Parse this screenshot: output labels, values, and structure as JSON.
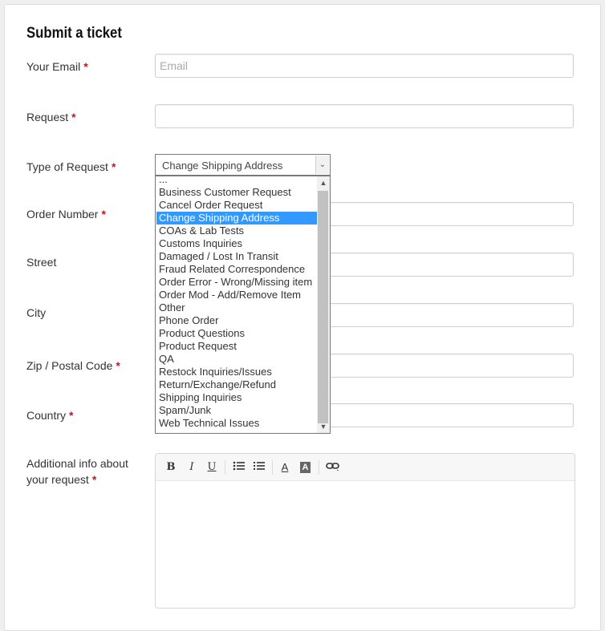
{
  "form": {
    "title": "Submit a ticket",
    "required_mark": "*",
    "email": {
      "label": "Your Email",
      "placeholder": "Email",
      "value": ""
    },
    "request": {
      "label": "Request",
      "value": ""
    },
    "type": {
      "label": "Type of Request",
      "selected": "Change Shipping Address",
      "options": [
        "...",
        "Business Customer Request",
        "Cancel Order Request",
        "Change Shipping Address",
        "COAs & Lab Tests",
        "Customs Inquiries",
        "Damaged / Lost In Transit",
        "Fraud Related Correspondence",
        "Order Error - Wrong/Missing item",
        "Order Mod - Add/Remove Item",
        "Other",
        "Phone Order",
        "Product Questions",
        "Product Request",
        "QA",
        "Restock Inquiries/Issues",
        "Return/Exchange/Refund",
        "Shipping Inquiries",
        "Spam/Junk",
        "Web Technical Issues"
      ]
    },
    "order_number": {
      "label": "Order Number"
    },
    "street": {
      "label": "Street"
    },
    "city": {
      "label": "City"
    },
    "zip": {
      "label": "Zip / Postal Code"
    },
    "country": {
      "label": "Country"
    },
    "additional": {
      "label_line1": "Additional info about",
      "label_line2": "your request"
    },
    "toolbar": {
      "bold": "B",
      "italic": "I",
      "underline": "U",
      "text_color": "A",
      "bg_color": "A"
    }
  },
  "colors": {
    "required": "#c4161c",
    "selected_option": "#3399ff"
  }
}
